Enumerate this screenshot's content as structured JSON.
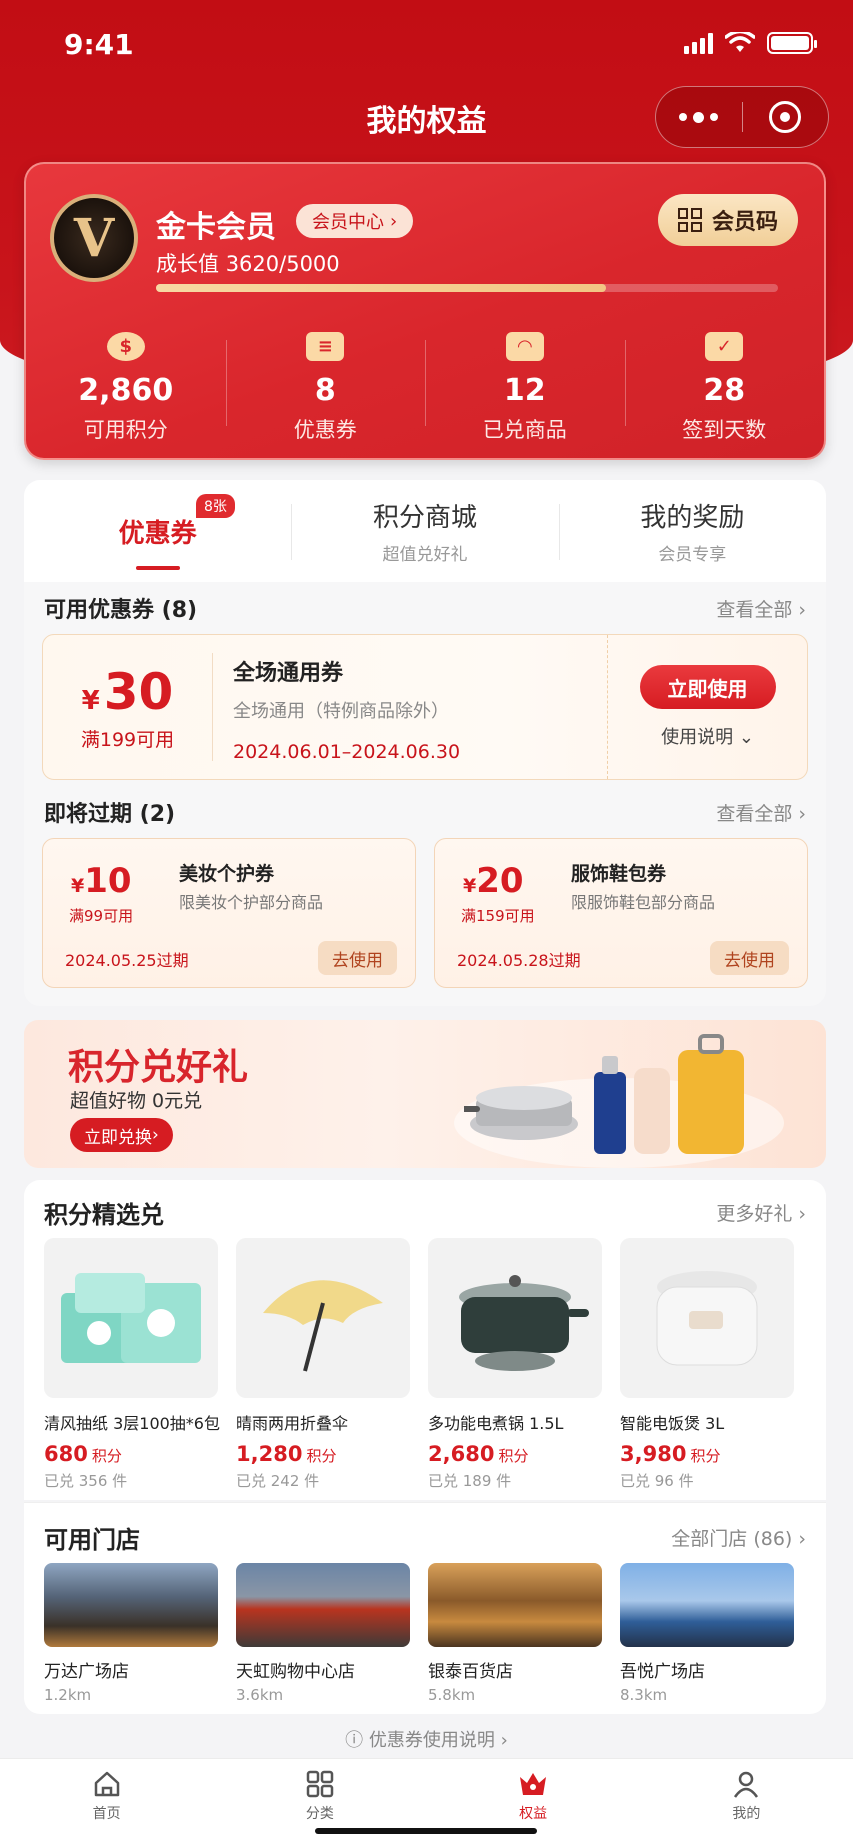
{
  "status_bar": {
    "time": "9:41"
  },
  "nav": {
    "title": "我的权益"
  },
  "member": {
    "level": "金卡会员",
    "center_link": "会员中心",
    "growth_label": "成长值",
    "growth_value": "3620/5000",
    "growth_fraction": 0.724,
    "code_button": "会员码",
    "stats": [
      {
        "value": "2,860",
        "label": "可用积分",
        "icon": "points-coin-icon"
      },
      {
        "value": "8",
        "label": "优惠券",
        "icon": "ticket-icon"
      },
      {
        "value": "12",
        "label": "已兑商品",
        "icon": "shopping-bag-icon"
      },
      {
        "value": "28",
        "label": "签到天数",
        "icon": "calendar-check-icon"
      }
    ]
  },
  "tabs": [
    {
      "title": "优惠券",
      "sub": "",
      "badge": "8张",
      "active": true
    },
    {
      "title": "积分商城",
      "sub": "超值兑好礼"
    },
    {
      "title": "我的奖励",
      "sub": "会员专享"
    }
  ],
  "available": {
    "title": "可用优惠券 (8)",
    "more": "查看全部",
    "coupon": {
      "currency": "¥",
      "amount": "30",
      "condition": "满199可用",
      "name": "全场通用券",
      "desc": "全场通用（特例商品除外）",
      "date": "2024.06.01–2024.06.30",
      "button": "立即使用",
      "note": "使用说明"
    }
  },
  "expiring": {
    "title": "即将过期 (2)",
    "more": "查看全部",
    "coupons": [
      {
        "currency": "¥",
        "amount": "10",
        "condition": "满99可用",
        "name": "美妆个护券",
        "desc": "限美妆个护部分商品",
        "expire": "2024.05.25过期",
        "button": "去使用"
      },
      {
        "currency": "¥",
        "amount": "20",
        "condition": "满159可用",
        "name": "服饰鞋包券",
        "desc": "限服饰鞋包部分商品",
        "expire": "2024.05.28过期",
        "button": "去使用"
      }
    ]
  },
  "banner": {
    "title": "积分兑好礼",
    "sub": "超值好物 0元兑",
    "button": "立即兑换"
  },
  "products": {
    "title": "积分精选兑",
    "more": "更多好礼",
    "items": [
      {
        "name": "清风抽纸 3层100抽*6包",
        "price": "680",
        "unit": "积分",
        "sold": "已兑 356 件"
      },
      {
        "name": "晴雨两用折叠伞",
        "price": "1,280",
        "unit": "积分",
        "sold": "已兑 242 件"
      },
      {
        "name": "多功能电煮锅 1.5L",
        "price": "2,680",
        "unit": "积分",
        "sold": "已兑 189 件"
      },
      {
        "name": "智能电饭煲 3L",
        "price": "3,980",
        "unit": "积分",
        "sold": "已兑 96 件"
      }
    ]
  },
  "stores": {
    "title": "可用门店",
    "more": "全部门店 (86)",
    "items": [
      {
        "name": "万达广场店",
        "distance": "1.2km"
      },
      {
        "name": "天虹购物中心店",
        "distance": "3.6km"
      },
      {
        "name": "银泰百货店",
        "distance": "5.8km"
      },
      {
        "name": "吾悦广场店",
        "distance": "8.3km"
      }
    ]
  },
  "help": {
    "text": "优惠券使用说明"
  },
  "tabbar": [
    {
      "label": "首页",
      "icon": "home-icon"
    },
    {
      "label": "分类",
      "icon": "category-grid-icon"
    },
    {
      "label": "权益",
      "icon": "crown-icon",
      "active": true
    },
    {
      "label": "我的",
      "icon": "user-icon"
    }
  ],
  "colors": {
    "brand_red": "#d61c22",
    "gold": "#f1cf98"
  }
}
